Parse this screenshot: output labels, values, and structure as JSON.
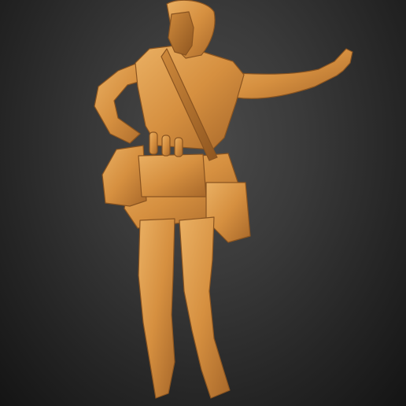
{
  "scene": {
    "subject_icon": "sculpted-figure-model",
    "colors": {
      "background_light": "#4a4a4a",
      "background_dark": "#141414",
      "clay_highlight": "#e8a95a",
      "clay_base": "#d69040",
      "clay_shadow": "#9a5e22"
    }
  }
}
